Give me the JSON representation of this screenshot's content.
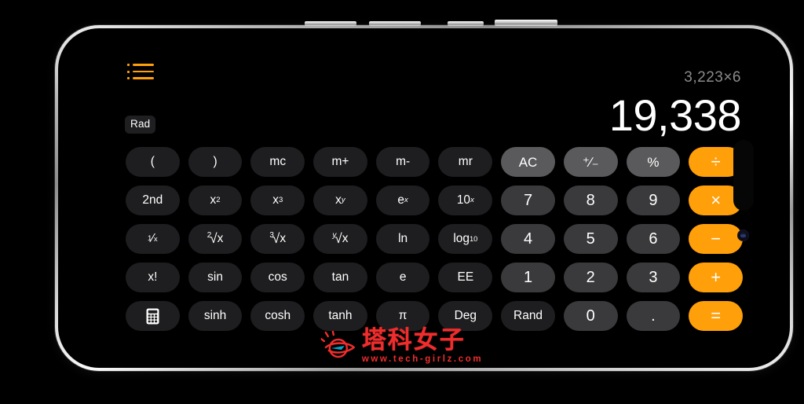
{
  "device": {
    "name": "iPhone",
    "orientation": "landscape",
    "hardware_buttons": [
      "volume-up",
      "volume-down",
      "action-button",
      "power-button"
    ]
  },
  "app": {
    "name": "Calculator",
    "mode": "scientific",
    "menu_icon": "list-menu-icon",
    "angle_unit_badge": "Rad"
  },
  "display": {
    "expression": "3,223×6",
    "result": "19,338"
  },
  "colors": {
    "accent": "#ff9f0a",
    "background": "#000000",
    "function_key": "#1e1e20",
    "number_key": "#3a3a3c",
    "utility_key": "#5a5a5c",
    "expression_text": "#8b8b8e",
    "result_text": "#ffffff",
    "watermark": "#ef2d2d"
  },
  "keypad": {
    "rows": [
      [
        {
          "label": "(",
          "type": "fn",
          "name": "key-open-paren"
        },
        {
          "label": ")",
          "type": "fn",
          "name": "key-close-paren"
        },
        {
          "label": "mc",
          "type": "fn",
          "name": "key-memory-clear"
        },
        {
          "label": "m+",
          "type": "fn",
          "name": "key-memory-add"
        },
        {
          "label": "m-",
          "type": "fn",
          "name": "key-memory-subtract"
        },
        {
          "label": "mr",
          "type": "fn",
          "name": "key-memory-recall"
        },
        {
          "label": "AC",
          "type": "util",
          "name": "key-all-clear"
        },
        {
          "label": "⁺∕₋",
          "type": "util",
          "name": "key-sign-toggle"
        },
        {
          "label": "%",
          "type": "util",
          "name": "key-percent"
        },
        {
          "label": "÷",
          "type": "op",
          "name": "key-divide"
        }
      ],
      [
        {
          "label": "2nd",
          "type": "fn",
          "name": "key-second-function"
        },
        {
          "label": "x²",
          "type": "fn",
          "name": "key-square",
          "html": "x<sup>2</sup>"
        },
        {
          "label": "x³",
          "type": "fn",
          "name": "key-cube",
          "html": "x<sup>3</sup>"
        },
        {
          "label": "xʸ",
          "type": "fn",
          "name": "key-power-y",
          "html": "x<sup><i>y</i></sup>"
        },
        {
          "label": "eˣ",
          "type": "fn",
          "name": "key-exp-e",
          "html": "e<sup><i>x</i></sup>"
        },
        {
          "label": "10ˣ",
          "type": "fn",
          "name": "key-exp-ten",
          "html": "10<sup><i>x</i></sup>"
        },
        {
          "label": "7",
          "type": "num",
          "name": "key-7"
        },
        {
          "label": "8",
          "type": "num",
          "name": "key-8"
        },
        {
          "label": "9",
          "type": "num",
          "name": "key-9"
        },
        {
          "label": "×",
          "type": "op",
          "name": "key-multiply"
        }
      ],
      [
        {
          "label": "¹/x",
          "type": "fn",
          "name": "key-reciprocal",
          "html": "<sup>1</sup>⁄<sub>x</sub>"
        },
        {
          "label": "²√x",
          "type": "fn",
          "name": "key-square-root",
          "html": "<span class='radical'><span class='idx'>2</span><span class='rad'>√</span></span>x"
        },
        {
          "label": "³√x",
          "type": "fn",
          "name": "key-cube-root",
          "html": "<span class='radical'><span class='idx'>3</span><span class='rad'>√</span></span>x"
        },
        {
          "label": "ʸ√x",
          "type": "fn",
          "name": "key-nth-root",
          "html": "<span class='radical'><span class='idx'><i>y</i></span><span class='rad'>√</span></span>x"
        },
        {
          "label": "ln",
          "type": "fn",
          "name": "key-natural-log"
        },
        {
          "label": "log₁₀",
          "type": "fn",
          "name": "key-log-base-10",
          "html": "log<sub>10</sub>"
        },
        {
          "label": "4",
          "type": "num",
          "name": "key-4"
        },
        {
          "label": "5",
          "type": "num",
          "name": "key-5"
        },
        {
          "label": "6",
          "type": "num",
          "name": "key-6"
        },
        {
          "label": "−",
          "type": "op",
          "name": "key-subtract"
        }
      ],
      [
        {
          "label": "x!",
          "type": "fn",
          "name": "key-factorial"
        },
        {
          "label": "sin",
          "type": "fn",
          "name": "key-sin"
        },
        {
          "label": "cos",
          "type": "fn",
          "name": "key-cos"
        },
        {
          "label": "tan",
          "type": "fn",
          "name": "key-tan"
        },
        {
          "label": "e",
          "type": "fn",
          "name": "key-euler-number"
        },
        {
          "label": "EE",
          "type": "fn",
          "name": "key-exponent-entry"
        },
        {
          "label": "1",
          "type": "num",
          "name": "key-1"
        },
        {
          "label": "2",
          "type": "num",
          "name": "key-2"
        },
        {
          "label": "3",
          "type": "num",
          "name": "key-3"
        },
        {
          "label": "+",
          "type": "op",
          "name": "key-add"
        }
      ],
      [
        {
          "label": "",
          "type": "fn",
          "name": "key-calculator-icon",
          "icon": "calculator-icon"
        },
        {
          "label": "sinh",
          "type": "fn",
          "name": "key-sinh"
        },
        {
          "label": "cosh",
          "type": "fn",
          "name": "key-cosh"
        },
        {
          "label": "tanh",
          "type": "fn",
          "name": "key-tanh"
        },
        {
          "label": "π",
          "type": "fn",
          "name": "key-pi"
        },
        {
          "label": "Deg",
          "type": "fn",
          "name": "key-degrees"
        },
        {
          "label": "Rand",
          "type": "fn",
          "name": "key-random"
        },
        {
          "label": "0",
          "type": "num",
          "name": "key-0"
        },
        {
          "label": ".",
          "type": "num",
          "name": "key-decimal-point"
        },
        {
          "label": "=",
          "type": "op eq",
          "name": "key-equals"
        }
      ]
    ]
  },
  "watermark": {
    "logo": "saturn-planet-icon",
    "brand": "塔科女子",
    "url": "www.tech-girlz.com"
  }
}
